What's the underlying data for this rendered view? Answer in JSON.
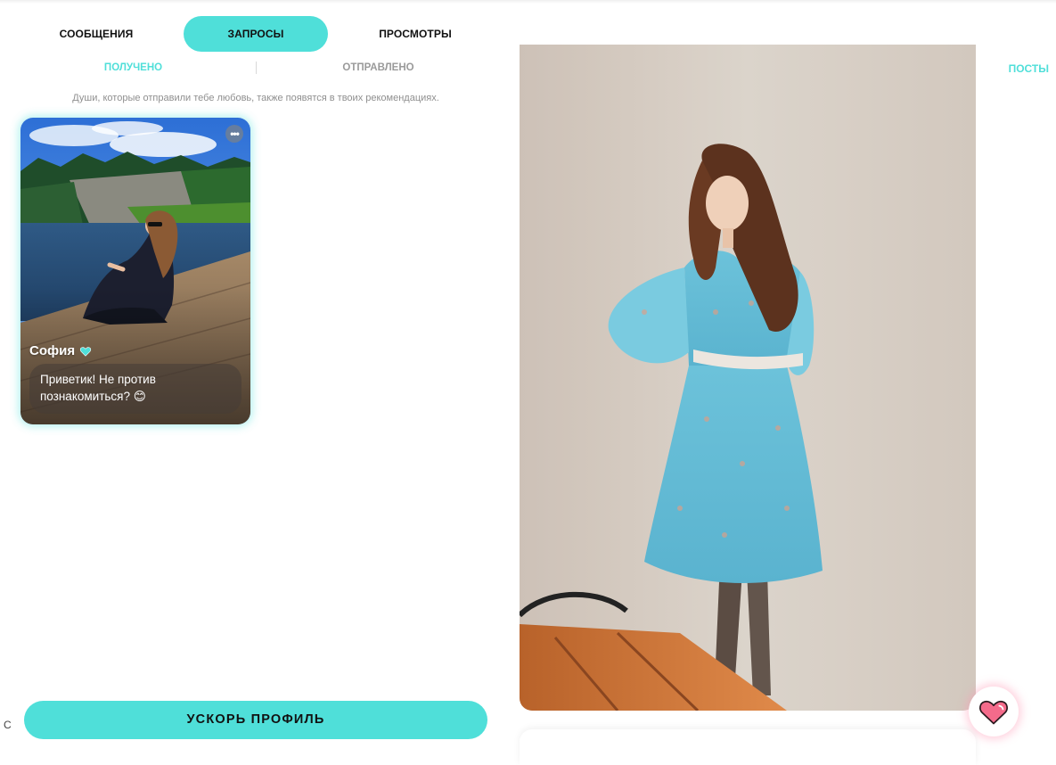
{
  "tabs": {
    "messages": "СООБЩЕНИЯ",
    "requests": "ЗАПРОСЫ",
    "views": "ПРОСМОТРЫ",
    "active": "requests"
  },
  "subtabs": {
    "received": "ПОЛУЧЕНО",
    "sent": "ОТПРАВЛЕНО",
    "active": "received"
  },
  "hint": "Души, которые отправили тебе любовь, также появятся в твоих рекомендациях.",
  "request_card": {
    "name": "София",
    "message": "Приветик! Не против познакомиться? 😊",
    "more_icon": "more-dots-icon",
    "badge_icon": "heart-badge-icon"
  },
  "boost_button": "УСКОРЬ ПРОФИЛЬ",
  "left_edge_letter": "С",
  "profile": {
    "posts_link": "ПОСТЫ"
  },
  "colors": {
    "accent": "#4fdfd9",
    "like_heart": "#f46b8b",
    "text_muted": "#8f8f8f"
  },
  "like_icon": "heart-like-icon"
}
